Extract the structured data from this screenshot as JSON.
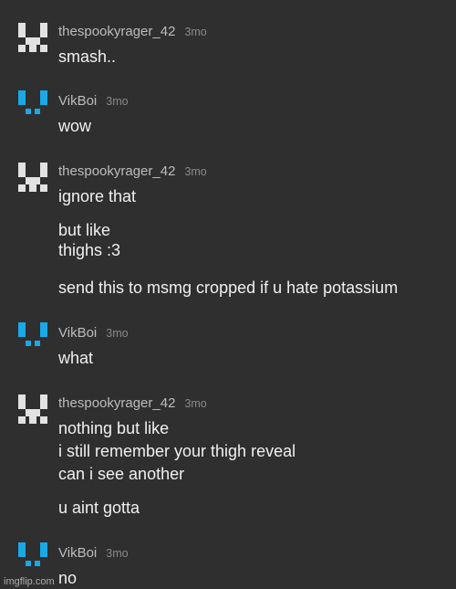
{
  "colors": {
    "background": "#2f2f2f",
    "avatar_spooky": "#e2e2e2",
    "avatar_vik": "#1aa9e6"
  },
  "messages": [
    {
      "user": "thespookyrager_42",
      "time": "3mo",
      "avatar": "white-pixel-avatar",
      "lines": [
        "smash.."
      ]
    },
    {
      "user": "VikBoi",
      "time": "3mo",
      "avatar": "blue-pixel-avatar",
      "lines": [
        "wow"
      ]
    },
    {
      "user": "thespookyrager_42",
      "time": "3mo",
      "avatar": "white-pixel-avatar",
      "lines": [
        "ignore that",
        "but like",
        "thighs :3",
        "send this to msmg cropped if u hate potassium"
      ]
    },
    {
      "user": "VikBoi",
      "time": "3mo",
      "avatar": "blue-pixel-avatar",
      "lines": [
        "what"
      ]
    },
    {
      "user": "thespookyrager_42",
      "time": "3mo",
      "avatar": "white-pixel-avatar",
      "lines": [
        "nothing but like",
        "i still remember your thigh reveal",
        "can i see another",
        "u aint gotta"
      ]
    },
    {
      "user": "VikBoi",
      "time": "3mo",
      "avatar": "blue-pixel-avatar",
      "lines": [
        "no"
      ]
    }
  ],
  "watermark": "imgflip.com"
}
